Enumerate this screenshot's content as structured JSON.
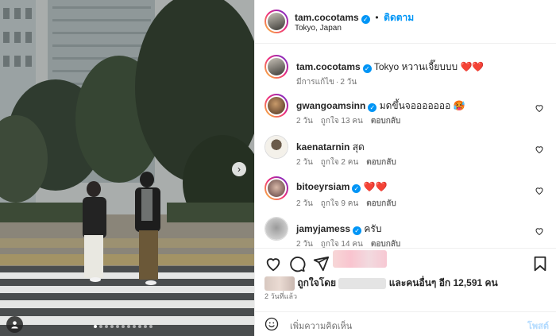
{
  "photo": {
    "next_icon": "chevron-right-icon",
    "tag_icon": "user-tag-icon",
    "dots_count": 11,
    "active_dot": 0
  },
  "header": {
    "username": "tam.cocotams",
    "separator": "•",
    "follow_label": "ติดตาม",
    "location": "Tokyo, Japan"
  },
  "caption": {
    "username": "tam.cocotams",
    "text": "Tokyo หวานเจี๊ยบบบ",
    "emoji": "❤️❤️",
    "edited": "มีการแก้ไข",
    "dot": "·",
    "time": "2 วัน"
  },
  "comments": [
    {
      "username": "gwangoamsinn",
      "verified": true,
      "text": "มดขึ้นจอออออออ 🥵",
      "time": "2 วัน",
      "likes": "ถูกใจ 13 คน",
      "reply": "ตอบกลับ"
    },
    {
      "username": "kaenatarnin",
      "verified": false,
      "text": "สุด",
      "time": "2 วัน",
      "likes": "ถูกใจ 2 คน",
      "reply": "ตอบกลับ"
    },
    {
      "username": "bitoeyrsiam",
      "verified": true,
      "text": "❤️❤️",
      "time": "2 วัน",
      "likes": "ถูกใจ 9 คน",
      "reply": "ตอบกลับ"
    },
    {
      "username": "jamyjamess",
      "verified": true,
      "text": "ครับ",
      "time": "2 วัน",
      "likes": "ถูกใจ 14 คน",
      "reply": "ตอบกลับ"
    }
  ],
  "actions": {
    "like_icon": "heart-outline-icon",
    "comment_icon": "comment-icon",
    "share_icon": "send-icon",
    "save_icon": "bookmark-icon",
    "liked_by_prefix": "ถูกใจโดย",
    "liked_by_suffix": "และคนอื่นๆ อีก 12,591 คน",
    "posted_time": "2 วันที่แล้ว"
  },
  "add_comment": {
    "emoji_icon": "smiley-icon",
    "placeholder": "เพิ่มความคิดเห็น",
    "post_label": "โพสต์"
  },
  "colors": {
    "accent": "#0095f6",
    "heart_red": "#ed1c24",
    "muted": "#737373"
  }
}
